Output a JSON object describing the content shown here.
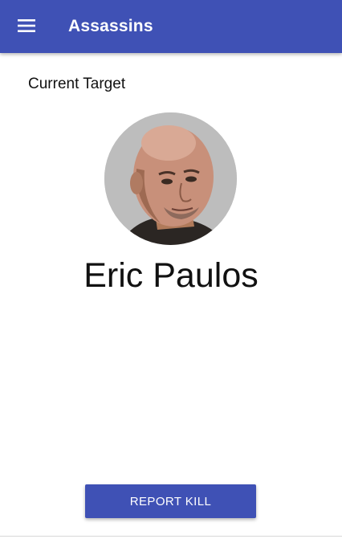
{
  "app_bar": {
    "title": "Assassins",
    "menu_icon": "hamburger-menu-icon",
    "background_color": "#3f51b5"
  },
  "main": {
    "section_label": "Current Target",
    "target": {
      "name": "Eric Paulos",
      "avatar": "target-avatar-photo"
    }
  },
  "actions": {
    "report_kill_label": "REPORT KILL",
    "button_color": "#3f51b5"
  }
}
